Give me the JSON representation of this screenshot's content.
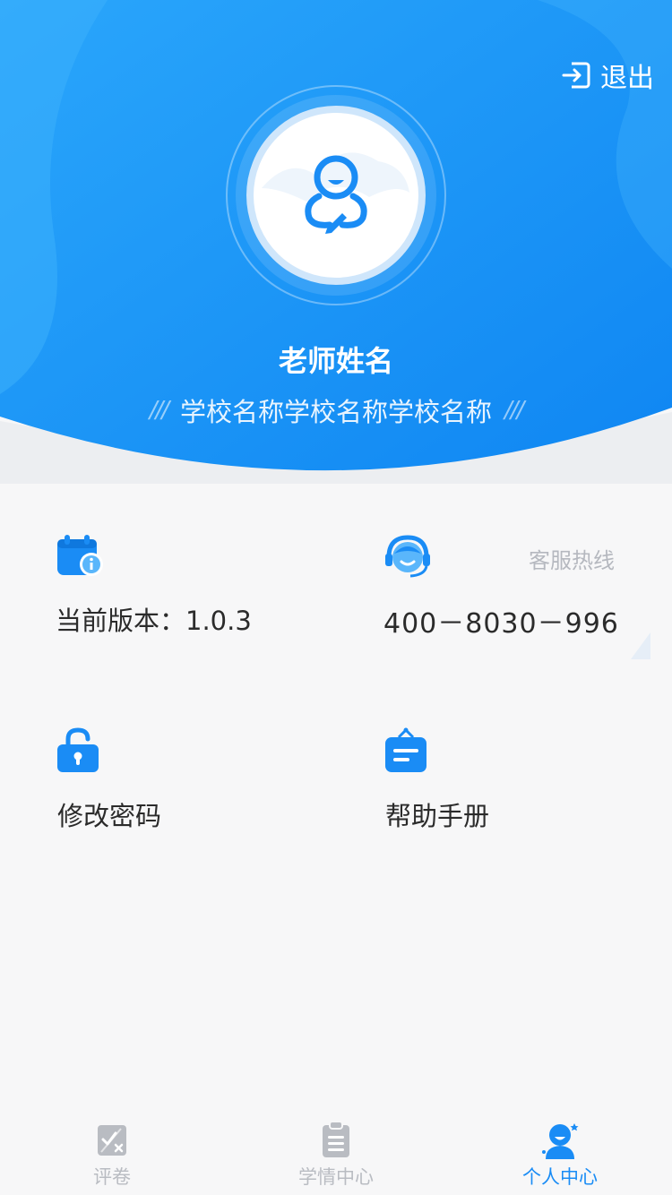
{
  "header": {
    "logout_label": "退出",
    "teacher_name": "老师姓名",
    "school_name": "学校名称学校名称学校名称",
    "deco_left": "///",
    "deco_right": "///"
  },
  "info": {
    "version_label": "当前版本：1.0.3",
    "hotline_title": "客服热线",
    "hotline_number": "400－8030－996",
    "change_password": "修改密码",
    "help_manual": "帮助手册"
  },
  "tabbar": {
    "tabs": [
      {
        "label": "评卷",
        "icon": "grading-icon",
        "active": false
      },
      {
        "label": "学情中心",
        "icon": "clipboard-icon",
        "active": false
      },
      {
        "label": "个人中心",
        "icon": "person-icon",
        "active": true
      }
    ]
  },
  "colors": {
    "primary": "#1a8cf5",
    "primary_light": "#4fb0fb",
    "inactive": "#b9bcc2",
    "text": "#2b2b2b",
    "muted": "#b5b8bf"
  }
}
